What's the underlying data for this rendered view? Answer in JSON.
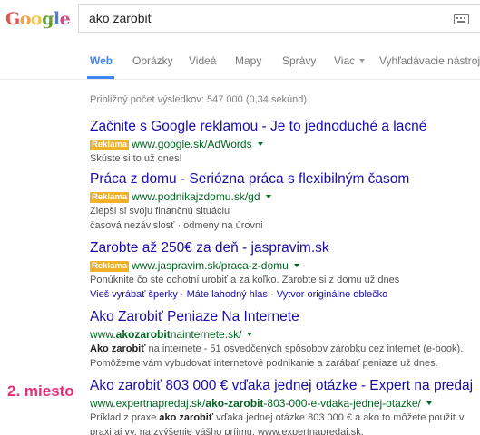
{
  "search": {
    "query": "ako zarobiť",
    "logo_letters": [
      {
        "ch": "G",
        "color": "#e1574b"
      },
      {
        "ch": "o",
        "color": "#f2a24a"
      },
      {
        "ch": "o",
        "color": "#f2c64a"
      },
      {
        "ch": "g",
        "color": "#6a9f3c"
      },
      {
        "ch": "l",
        "color": "#4f7fd1"
      },
      {
        "ch": "e",
        "color": "#d44c8a"
      }
    ]
  },
  "tabs": [
    {
      "label": "Web",
      "active": true
    },
    {
      "label": "Obrázky"
    },
    {
      "label": "Videá"
    },
    {
      "label": "Mapy"
    },
    {
      "label": "Správy"
    },
    {
      "label": "Viac"
    },
    {
      "label": "Vyhľadávacie nástroje"
    }
  ],
  "stats": "Približný počet výsledkov: 547 000 (0,34 sekúnd)",
  "ad_label": "Reklama",
  "results": [
    {
      "title": "Začnite s Google reklamou - Je to jednoduché a lacné",
      "url": "www.google.sk/AdWords",
      "desc": [
        "Skúste si to už dnes!"
      ]
    },
    {
      "title": "Práca z domu - Seriózna práca s flexibilným časom",
      "url": "www.podnikajzdomu.sk/gd",
      "desc": [
        "Zlepši si svoju finančnú situáciu",
        "časová nezávislosť · odmeny na úrovni"
      ]
    },
    {
      "title": "Zarobte až 250€ za deň - jaspravim.sk",
      "url": "www.jaspravim.sk/praca-z-domu",
      "desc": [
        "Ponúknite čo ste ochotní urobiť a za koľko. Zarobte si z domu už dnes"
      ],
      "links": [
        "Vieš vyrábať šperky",
        "Máte lahodný hlas",
        "Vytvor originálne oblečko"
      ]
    },
    {
      "title": "Ako Zarobiť Peniaze Na Internete",
      "url_pre": "www.",
      "url_bold": "akozarobit",
      "url_post": "nainternete.sk/",
      "desc_bold": "Ako zarobiť",
      "desc_rest": " na internete - 51 osvedčených spôsobov zárobku cez internet (e-book).",
      "desc2": "Pomôžeme vám vybudovať internetové podnikanie a zarábať peniaze už dnes."
    },
    {
      "title": "Ako zarobiť 803 000 € vďaka jednej otázke - Expert na predaj",
      "url_pre": "www.expertnapredaj.sk/",
      "url_bold": "ako-zarobit",
      "url_post": "-803-000-e-vdaka-jednej-otazke/",
      "desc_pre": "Príklad z praxe ",
      "desc_bold": "ako zarobiť",
      "desc_rest": " vďaka jednej otázke 803 000 € a ako to môžete použiť v",
      "desc2": "praxi aj vy, na zvýšenie vášho príjmu. www.expertnapredaj.sk."
    }
  ],
  "annotation": "2. miesto",
  "colors": {
    "link": "#1a0dab",
    "url": "#006621",
    "ad_badge": "#f0b128",
    "annotation": "#e6307b",
    "tab_active": "#4285f4"
  }
}
